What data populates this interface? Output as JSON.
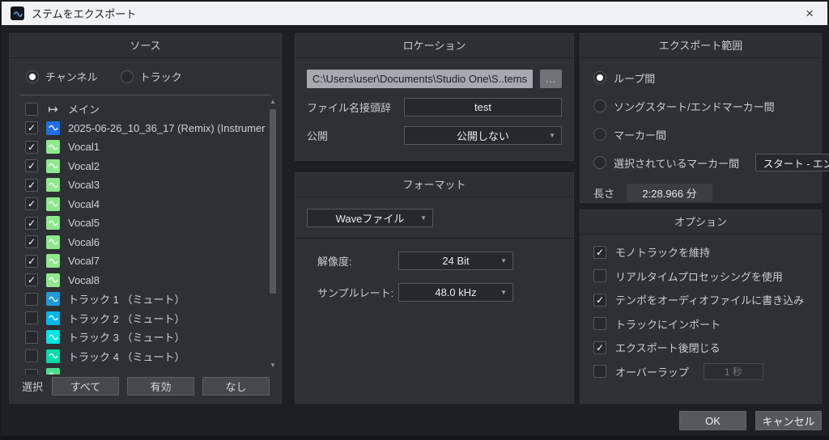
{
  "window": {
    "title": "ステムをエクスポート",
    "close": "×"
  },
  "icons": {
    "up": "▲",
    "down": "▼",
    "caret": "▼",
    "check": "✓",
    "main_out": "↦"
  },
  "source": {
    "header": "ソース",
    "radios": [
      {
        "label": "チャンネル",
        "selected": true
      },
      {
        "label": "トラック",
        "selected": false
      }
    ],
    "tracks": [
      {
        "label": "メイン",
        "checked": false,
        "icon": "main-out",
        "color": ""
      },
      {
        "label": "2025-06-26_10_36_17 (Remix) (Instrumer",
        "checked": true,
        "icon": "wave",
        "color": "#1e6fe6"
      },
      {
        "label": "Vocal1",
        "checked": true,
        "icon": "wave",
        "color": "#8ee88c"
      },
      {
        "label": "Vocal2",
        "checked": true,
        "icon": "wave",
        "color": "#8ee88c"
      },
      {
        "label": "Vocal3",
        "checked": true,
        "icon": "wave",
        "color": "#8ee88c"
      },
      {
        "label": "Vocal4",
        "checked": true,
        "icon": "wave",
        "color": "#8ee88c"
      },
      {
        "label": "Vocal5",
        "checked": true,
        "icon": "wave",
        "color": "#8ee88c"
      },
      {
        "label": "Vocal6",
        "checked": true,
        "icon": "wave",
        "color": "#8ee88c"
      },
      {
        "label": "Vocal7",
        "checked": true,
        "icon": "wave",
        "color": "#8ee88c"
      },
      {
        "label": "Vocal8",
        "checked": true,
        "icon": "wave",
        "color": "#8ee88c"
      },
      {
        "label": "トラック 1 （ミュート）",
        "checked": false,
        "icon": "wave",
        "color": "#1f9ad8"
      },
      {
        "label": "トラック 2 （ミュート）",
        "checked": false,
        "icon": "wave",
        "color": "#00b8e8"
      },
      {
        "label": "トラック 3 （ミュート）",
        "checked": false,
        "icon": "wave",
        "color": "#00e4e4"
      },
      {
        "label": "トラック 4 （ミュート）",
        "checked": false,
        "icon": "wave",
        "color": "#00dcaa"
      },
      {
        "label": "",
        "checked": false,
        "icon": "wave",
        "color": "#4ae08e"
      }
    ],
    "select_label": "選択",
    "buttons": [
      {
        "label": "すべて",
        "name": "select-all-button"
      },
      {
        "label": "有効",
        "name": "select-enabled-button"
      },
      {
        "label": "なし",
        "name": "select-none-button"
      }
    ]
  },
  "location": {
    "header": "ロケーション",
    "path": "C:\\Users\\user\\Documents\\Studio One\\S..tems",
    "browse": "...",
    "prefix_label": "ファイル名接頭辞",
    "prefix_value": "test",
    "publish_label": "公開",
    "publish_value": "公開しない"
  },
  "format": {
    "header": "フォーマット",
    "file_type": "Waveファイル",
    "resolution_label": "解像度:",
    "resolution_value": "24 Bit",
    "samplerate_label": "サンプルレート:",
    "samplerate_value": "48.0 kHz"
  },
  "export_range": {
    "header": "エクスポート範囲",
    "options": [
      {
        "label": "ループ間",
        "selected": true
      },
      {
        "label": "ソングスタート/エンドマーカー間",
        "selected": false
      },
      {
        "label": "マーカー間",
        "selected": false
      },
      {
        "label": "選択されているマーカー間",
        "selected": false
      }
    ],
    "marker_range_value": "スタート - エンド",
    "length_label": "長さ",
    "length_value": "2:28.966 分"
  },
  "options": {
    "header": "オプション",
    "items": [
      {
        "label": "モノトラックを維持",
        "checked": true
      },
      {
        "label": "リアルタイムプロセッシングを使用",
        "checked": false
      },
      {
        "label": "テンポをオーディオファイルに書き込み",
        "checked": true
      },
      {
        "label": "トラックにインポート",
        "checked": false
      },
      {
        "label": "エクスポート後閉じる",
        "checked": true
      },
      {
        "label": "オーバーラップ",
        "checked": false
      }
    ],
    "overlap_value": "1 秒"
  },
  "footer": {
    "ok": "OK",
    "cancel": "キャンセル"
  }
}
